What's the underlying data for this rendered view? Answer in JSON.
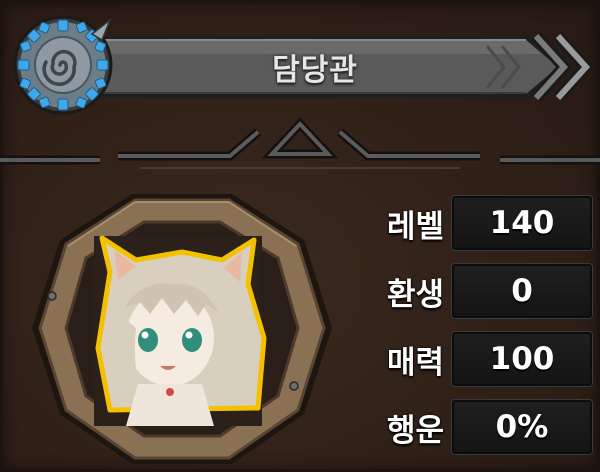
{
  "header": {
    "title": "담당관",
    "emblem_icon": "spiral-emblem-icon",
    "next_icon": "chevron-right-icon"
  },
  "portrait": {
    "icon": "cat-eared-character-portrait"
  },
  "stats": [
    {
      "label": "레벨",
      "value": "140"
    },
    {
      "label": "환생",
      "value": "0"
    },
    {
      "label": "매력",
      "value": "100"
    },
    {
      "label": "행운",
      "value": "0%"
    }
  ],
  "colors": {
    "background": "#2f2119",
    "title_bar": "#545454",
    "emblem_blue": "#3fa6e6",
    "portrait_frame": "#8c7356",
    "portrait_border": "#f2c200",
    "stat_box": "#1a1a1a"
  }
}
